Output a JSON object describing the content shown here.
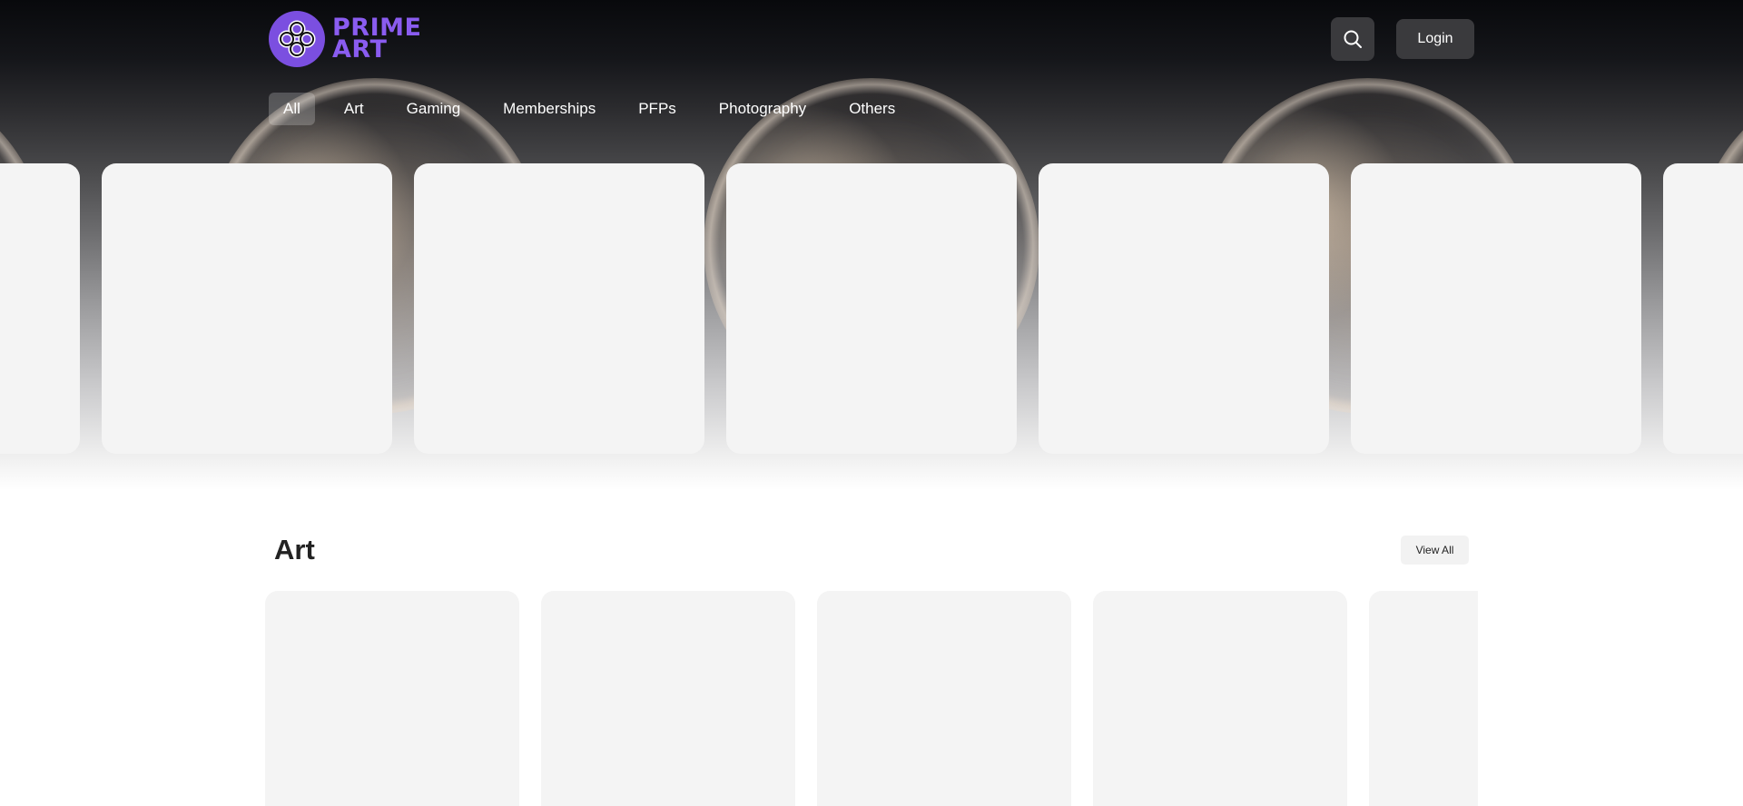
{
  "header": {
    "logo_line1": "PRIME",
    "logo_line2": "ART",
    "logo_icon": "prime-art-knot-icon",
    "search_icon": "search-icon",
    "login_label": "Login"
  },
  "nav": {
    "items": [
      "All",
      "Art",
      "Gaming",
      "Memberships",
      "PFPs",
      "Photography",
      "Others"
    ],
    "active": "All"
  },
  "art_section": {
    "title": "Art",
    "view_all_label": "View All"
  },
  "colors": {
    "brand": "#8a5cf0",
    "button_dark": "#3a3a3d",
    "card_placeholder": "#f4f4f4"
  }
}
